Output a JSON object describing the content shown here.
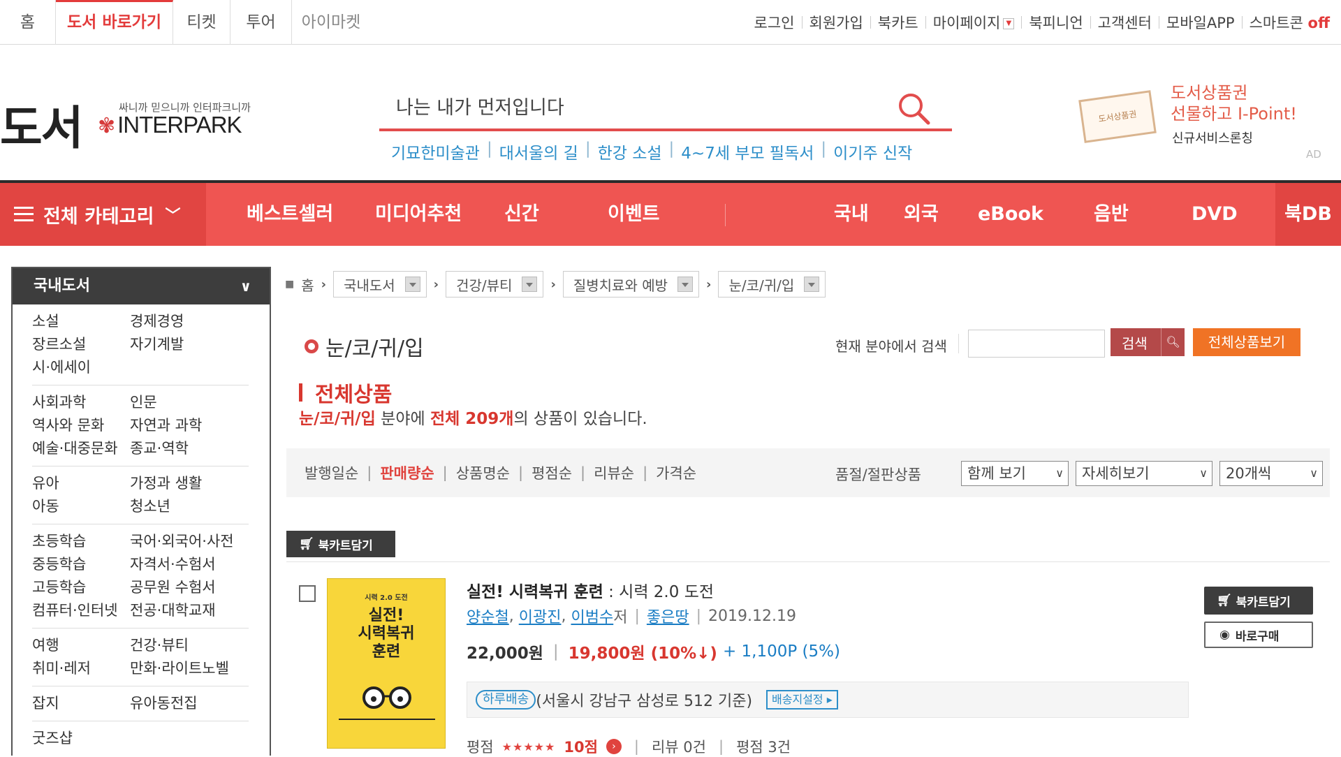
{
  "topbar": {
    "tabs": [
      "홈",
      "도서 바로가기",
      "티켓",
      "투어",
      "아이마켓"
    ],
    "util": [
      "로그인",
      "회원가입",
      "북카트",
      "마이페이지",
      "북피니언",
      "고객센터",
      "모바일APP",
      "스마트콘"
    ],
    "util_off": "off"
  },
  "header": {
    "logo_main": "도서",
    "logo_tagline": "싸니까 믿으니까 인터파크니까",
    "logo_brand": "INTERPARK",
    "search_value": "나는 내가 먼저입니다",
    "keywords": [
      "기묘한미술관",
      "대서울의 길",
      "한강 소설",
      "4~7세 부모 필독서",
      "이기주 신작"
    ],
    "ad_stamp": "도서상품권",
    "ad_title_1": "도서상품권",
    "ad_title_2": "선물하고 I-Point!",
    "ad_sub": "신규서비스론칭",
    "ad_mark": "AD"
  },
  "gnb": {
    "category": "전체 카테고리",
    "items": [
      "베스트셀러",
      "미디어추천",
      "신간",
      "이벤트"
    ],
    "right_items": [
      "국내",
      "외국",
      "eBook",
      "음반",
      "DVD"
    ],
    "db": "북DB"
  },
  "sidebar": {
    "title": "국내도서",
    "groups": [
      [
        [
          "소설",
          "경제경영"
        ],
        [
          "장르소설",
          "자기계발"
        ],
        [
          "시·에세이",
          ""
        ]
      ],
      [
        [
          "사회과학",
          "인문"
        ],
        [
          "역사와 문화",
          "자연과 과학"
        ],
        [
          "예술·대중문화",
          "종교·역학"
        ]
      ],
      [
        [
          "유아",
          "가정과 생활"
        ],
        [
          "아동",
          "청소년"
        ]
      ],
      [
        [
          "초등학습",
          "국어·외국어·사전"
        ],
        [
          "중등학습",
          "자격서·수험서"
        ],
        [
          "고등학습",
          "공무원 수험서"
        ],
        [
          "컴퓨터·인터넷",
          "전공·대학교재"
        ]
      ],
      [
        [
          "여행",
          "건강·뷰티"
        ],
        [
          "취미·레저",
          "만화·라이트노벨"
        ]
      ],
      [
        [
          "잡지",
          "유아동전집"
        ]
      ],
      [
        [
          "굿즈샵",
          ""
        ]
      ]
    ]
  },
  "breadcrumb": {
    "home": "홈",
    "levels": [
      "국내도서",
      "건강/뷰티",
      "질병치료와 예방",
      "눈/코/귀/입"
    ]
  },
  "category": {
    "title": "눈/코/귀/입",
    "search_label": "현재 분야에서 검색",
    "search_btn": "검색",
    "all_btn": "전체상품보기"
  },
  "section": {
    "title": "전체상품",
    "count_cat": "눈/코/귀/입",
    "count_mid": " 분야에 ",
    "count_total": "전체  209개",
    "count_end": "의 상품이 있습니다."
  },
  "sort": {
    "items": [
      "발행일순",
      "판매량순",
      "상품명순",
      "평점순",
      "리뷰순",
      "가격순"
    ],
    "active_index": 1,
    "soldout_label": "품절/절판상품",
    "dd1": "함께 보기",
    "dd2": "자세히보기",
    "dd3": "20개씩"
  },
  "cart_top": "북카트담기",
  "product": {
    "cover_small": "시력 2.0 도전",
    "cover_big_1": "실전!",
    "cover_big_2": "시력복귀",
    "cover_big_3": "훈련",
    "title_main": "실전! 시력복귀 훈련",
    "title_sub": " : 시력 2.0 도전",
    "authors": [
      "양순철",
      "이광진",
      "이범수"
    ],
    "author_suffix": " 저",
    "publisher": "좋은땅",
    "date": "2019.12.19",
    "price_orig": "22,000원",
    "price_sale": "19,800원 (10%↓)",
    "point": "+ 1,100P (5%)",
    "delivery_badge": "하루배송",
    "delivery_text": "(서울시 강남구 삼성로 512 기준)",
    "delivery_btn": "배송지설정 ▸",
    "rating_label": "평점",
    "rating_stars": "★★★★★",
    "rating_pts": "10점",
    "review": "리뷰 0건",
    "rating_count": "평점 3건",
    "btn_cart": "북카트담기",
    "btn_buy": "바로구매"
  },
  "colors": {
    "accent": "#ef5552",
    "link": "#1a7dc4",
    "price": "#d8372f",
    "orange": "#f07325"
  }
}
